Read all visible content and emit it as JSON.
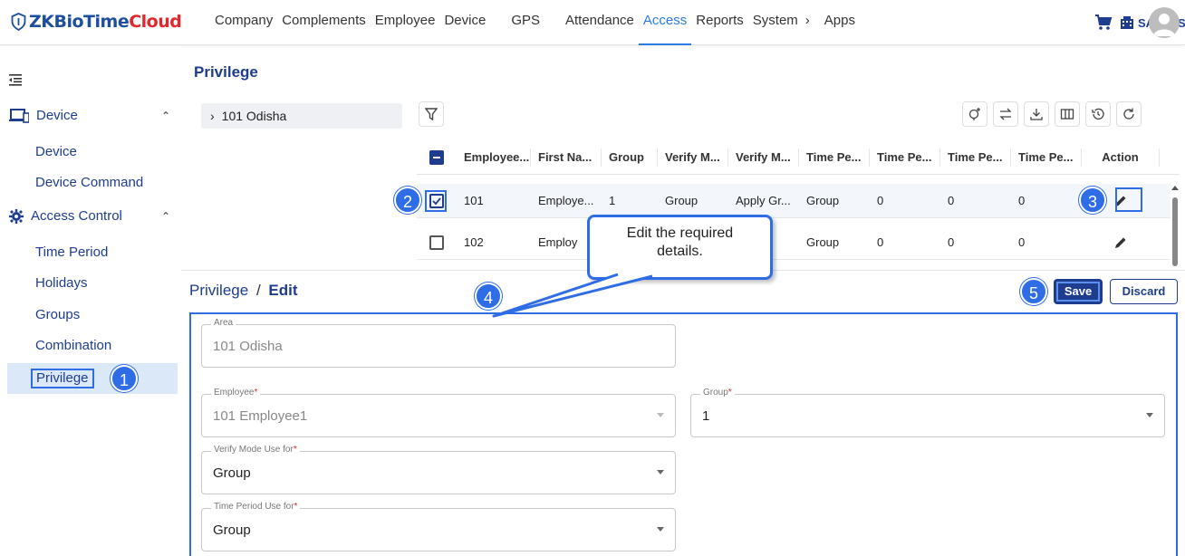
{
  "header": {
    "logo_main": "ZKBioTime",
    "logo_accent": "Cloud",
    "nav": [
      "Company",
      "Complements",
      "Employee",
      "Device",
      "GPS",
      "Attendance",
      "Access",
      "Reports",
      "System",
      "›",
      "Apps"
    ],
    "active_nav": "Access",
    "tenant": "SANTEST",
    "icons": [
      "shield-logo-icon",
      "cart-icon",
      "building-icon",
      "avatar-icon"
    ]
  },
  "sidebar": {
    "groups": [
      {
        "label": "Device",
        "icon": "device-icon",
        "items": [
          "Device",
          "Device Command"
        ]
      },
      {
        "label": "Access Control",
        "icon": "gear-icon",
        "items": [
          "Time Period",
          "Holidays",
          "Groups",
          "Combination",
          "Privilege"
        ]
      }
    ],
    "active_item": "Privilege"
  },
  "page": {
    "title": "Privilege",
    "tree_node": "101 Odisha"
  },
  "grid": {
    "columns": [
      "Employee...",
      "First Na...",
      "Group",
      "Verify M...",
      "Verify M...",
      "Time Pe...",
      "Time Pe...",
      "Time Pe...",
      "Time Pe...",
      "Action"
    ],
    "rows": [
      {
        "checked": true,
        "cells": [
          "101",
          "Employe...",
          "1",
          "Group",
          "Apply Gr...",
          "Group",
          "0",
          "0",
          "0"
        ]
      },
      {
        "checked": false,
        "cells": [
          "102",
          "Employ",
          "",
          "",
          "y Gr...",
          "Group",
          "0",
          "0",
          "0"
        ]
      }
    ]
  },
  "edit": {
    "crumb_parent": "Privilege",
    "crumb_sep": "/",
    "crumb_current": "Edit",
    "save": "Save",
    "discard": "Discard",
    "fields": {
      "area": {
        "label": "Area",
        "value": "101 Odisha"
      },
      "employee": {
        "label": "Employee",
        "value": "101 Employee1",
        "required": "*"
      },
      "group": {
        "label": "Group",
        "value": "1",
        "required": "*"
      },
      "verify_mode": {
        "label": "Verify Mode Use for",
        "value": "Group",
        "required": "*"
      },
      "time_period": {
        "label": "Time Period Use for",
        "value": "Group",
        "required": "*"
      }
    }
  },
  "callouts": {
    "bubble_line1": "Edit the required",
    "bubble_line2": "details.",
    "markers": [
      "1",
      "2",
      "3",
      "4",
      "5"
    ]
  },
  "colors": {
    "brand_blue": "#1e3d8f",
    "accent_blue": "#2f6de6",
    "logo_red": "#e0282e",
    "active_nav": "#2c7be0"
  }
}
